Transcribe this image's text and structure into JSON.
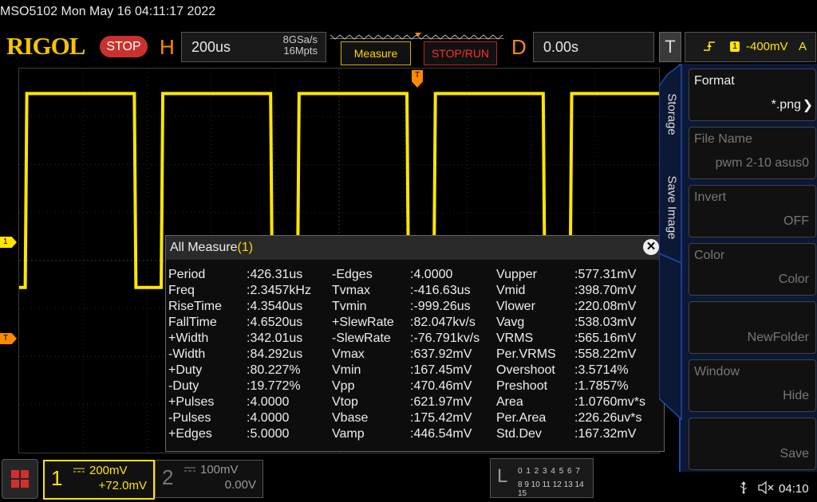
{
  "status": {
    "model_time": "MSO5102  Mon May 16 04:11:17 2022"
  },
  "header": {
    "logo": "RIGOL",
    "run_state": "STOP",
    "horizontal": {
      "letter": "H",
      "timebase": "200us",
      "sample_rate": "8GSa/s",
      "memory_depth": "16Mpts"
    },
    "measure_button": "Measure",
    "stoprun_button": "STOP/RUN",
    "delay": {
      "letter": "D",
      "value": "0.00s"
    },
    "trigger": {
      "letter": "T",
      "channel": "1",
      "level": "-400mV",
      "mode": "A",
      "edge_icon": "rising-edge-icon"
    }
  },
  "markers": {
    "ch1": "1",
    "trigger": "T",
    "trigger_position": "T"
  },
  "waveform": {
    "color": "#ffe600",
    "high_level_fraction": 0.935,
    "low_level_fraction": 0.43,
    "transitions_us": [
      19,
      360,
      444,
      786,
      870,
      1212,
      1296,
      1638,
      1722
    ]
  },
  "measure_panel": {
    "title": "All Measure",
    "count": "(1)",
    "columns": [
      [
        {
          "name": "Period",
          "value": ":426.31us"
        },
        {
          "name": "Freq",
          "value": ":2.3457kHz"
        },
        {
          "name": "RiseTime",
          "value": ":4.3540us"
        },
        {
          "name": "FallTime",
          "value": ":4.6520us"
        },
        {
          "name": "+Width",
          "value": ":342.01us"
        },
        {
          "name": "-Width",
          "value": ":84.292us"
        },
        {
          "name": "+Duty",
          "value": ":80.227%"
        },
        {
          "name": "-Duty",
          "value": ":19.772%"
        },
        {
          "name": "+Pulses",
          "value": ":4.0000"
        },
        {
          "name": "-Pulses",
          "value": ":4.0000"
        },
        {
          "name": "+Edges",
          "value": ":5.0000"
        }
      ],
      [
        {
          "name": "-Edges",
          "value": ":4.0000"
        },
        {
          "name": "Tvmax",
          "value": ":-416.63us"
        },
        {
          "name": "Tvmin",
          "value": ":-999.26us"
        },
        {
          "name": "+SlewRate",
          "value": ":82.047kv/s"
        },
        {
          "name": "-SlewRate",
          "value": ":-76.791kv/s"
        },
        {
          "name": "Vmax",
          "value": ":637.92mV"
        },
        {
          "name": "Vmin",
          "value": ":167.45mV"
        },
        {
          "name": "Vpp",
          "value": ":470.46mV"
        },
        {
          "name": "Vtop",
          "value": ":621.97mV"
        },
        {
          "name": "Vbase",
          "value": ":175.42mV"
        },
        {
          "name": "Vamp",
          "value": ":446.54mV"
        }
      ],
      [
        {
          "name": "Vupper",
          "value": ":577.31mV"
        },
        {
          "name": "Vmid",
          "value": ":398.70mV"
        },
        {
          "name": "Vlower",
          "value": ":220.08mV"
        },
        {
          "name": "Vavg",
          "value": ":538.03mV"
        },
        {
          "name": "VRMS",
          "value": ":565.16mV"
        },
        {
          "name": "Per.VRMS",
          "value": ":558.22mV"
        },
        {
          "name": "Overshoot",
          "value": ":3.5714%"
        },
        {
          "name": "Preshoot",
          "value": ":1.7857%"
        },
        {
          "name": "Area",
          "value": ":1.0760mv*s"
        },
        {
          "name": "Per.Area",
          "value": ":226.26uv*s"
        },
        {
          "name": "Std.Dev",
          "value": ":167.32mV"
        }
      ]
    ]
  },
  "side_menu": {
    "tabs": [
      "Storage",
      "Save Image"
    ],
    "items": [
      {
        "label": "Format",
        "value": "*.png",
        "enabled": true,
        "chevron": true
      },
      {
        "label": "File Name",
        "value": "pwm 2-10 asus0",
        "enabled": false,
        "chevron": false
      },
      {
        "label": "Invert",
        "value": "OFF",
        "enabled": false,
        "chevron": false
      },
      {
        "label": "Color",
        "value": "Color",
        "enabled": false,
        "chevron": false
      },
      {
        "label": "",
        "value": "NewFolder",
        "enabled": false,
        "chevron": false
      },
      {
        "label": "Window",
        "value": "Hide",
        "enabled": false,
        "chevron": false
      },
      {
        "label": "",
        "value": "Save",
        "enabled": false,
        "chevron": false
      }
    ]
  },
  "footer": {
    "ch1": {
      "num": "1",
      "scale": "200mV",
      "offset": "+72.0mV"
    },
    "ch2": {
      "num": "2",
      "scale": "100mV",
      "offset": "0.00V"
    },
    "la": {
      "letter": "L",
      "row1": "0 1 2 3  4 5 6 7",
      "row2": "8 9 10 11 12 13 14 15"
    },
    "clock": "04:10",
    "usb_icon": "usb-icon",
    "sound_icon": "speaker-muted-icon"
  }
}
